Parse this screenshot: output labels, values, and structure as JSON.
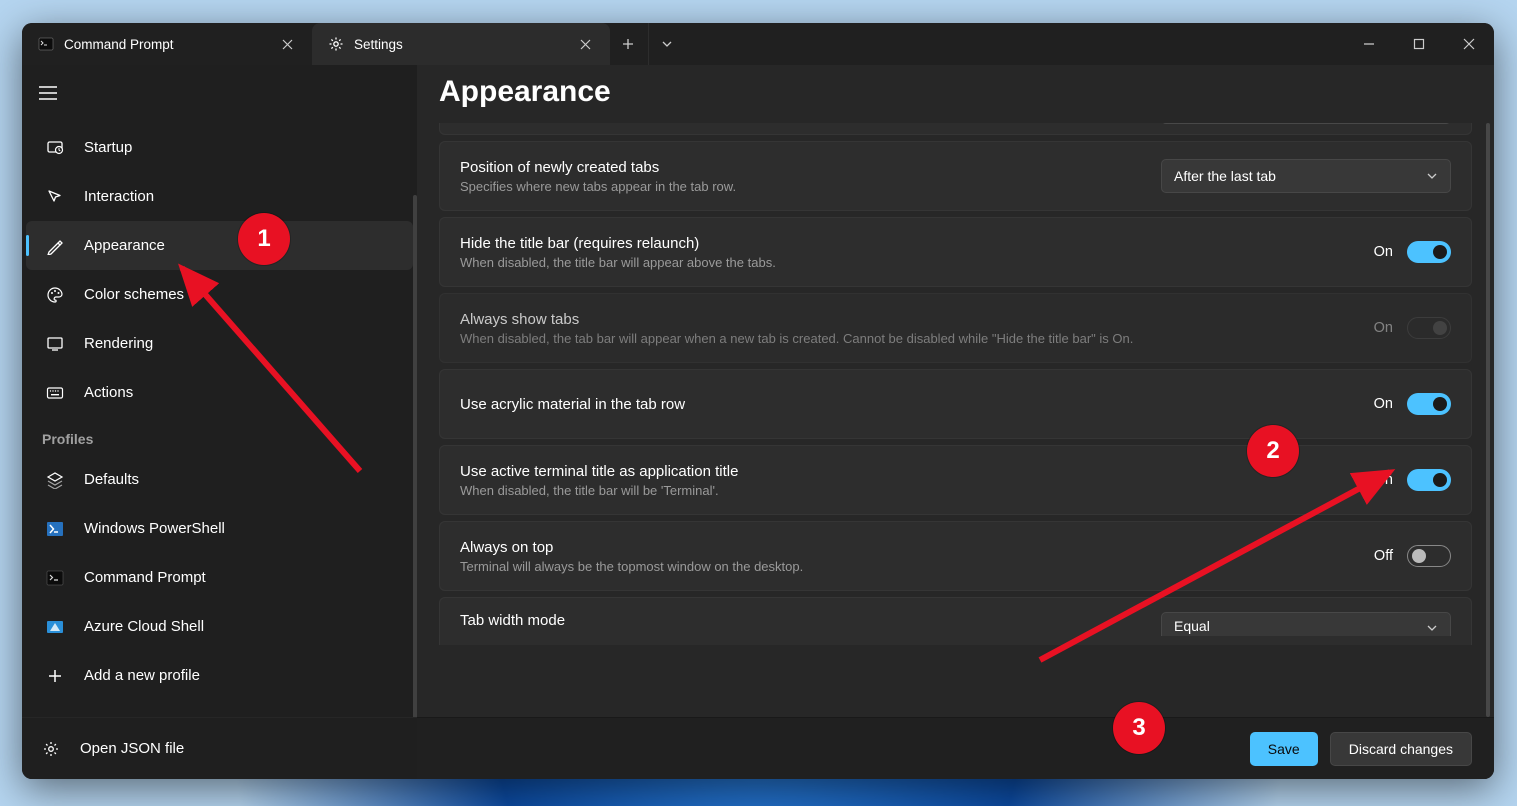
{
  "tabs": {
    "inactive": {
      "label": "Command Prompt"
    },
    "active": {
      "label": "Settings"
    }
  },
  "sidebar": {
    "items": [
      {
        "label": "Startup"
      },
      {
        "label": "Interaction"
      },
      {
        "label": "Appearance"
      },
      {
        "label": "Color schemes"
      },
      {
        "label": "Rendering"
      },
      {
        "label": "Actions"
      }
    ],
    "profiles_header": "Profiles",
    "profiles": [
      {
        "label": "Defaults"
      },
      {
        "label": "Windows PowerShell"
      },
      {
        "label": "Command Prompt"
      },
      {
        "label": "Azure Cloud Shell"
      },
      {
        "label": "Add a new profile"
      }
    ],
    "footer": "Open JSON file"
  },
  "main": {
    "title": "Appearance",
    "settings": {
      "position": {
        "title": "Position of newly created tabs",
        "desc": "Specifies where new tabs appear in the tab row.",
        "value": "After the last tab"
      },
      "hide_title": {
        "title": "Hide the title bar (requires relaunch)",
        "desc": "When disabled, the title bar will appear above the tabs.",
        "state": "On"
      },
      "always_show_tabs": {
        "title": "Always show tabs",
        "desc": "When disabled, the tab bar will appear when a new tab is created. Cannot be disabled while \"Hide the title bar\" is On.",
        "state": "On"
      },
      "acrylic": {
        "title": "Use acrylic material in the tab row",
        "state": "On"
      },
      "active_title": {
        "title": "Use active terminal title as application title",
        "desc": "When disabled, the title bar will be 'Terminal'.",
        "state": "On"
      },
      "always_on_top": {
        "title": "Always on top",
        "desc": "Terminal will always be the topmost window on the desktop.",
        "state": "Off"
      },
      "tab_width": {
        "title": "Tab width mode",
        "value": "Equal"
      }
    }
  },
  "footer": {
    "save": "Save",
    "discard": "Discard changes"
  },
  "annotations": {
    "one": "1",
    "two": "2",
    "three": "3"
  }
}
